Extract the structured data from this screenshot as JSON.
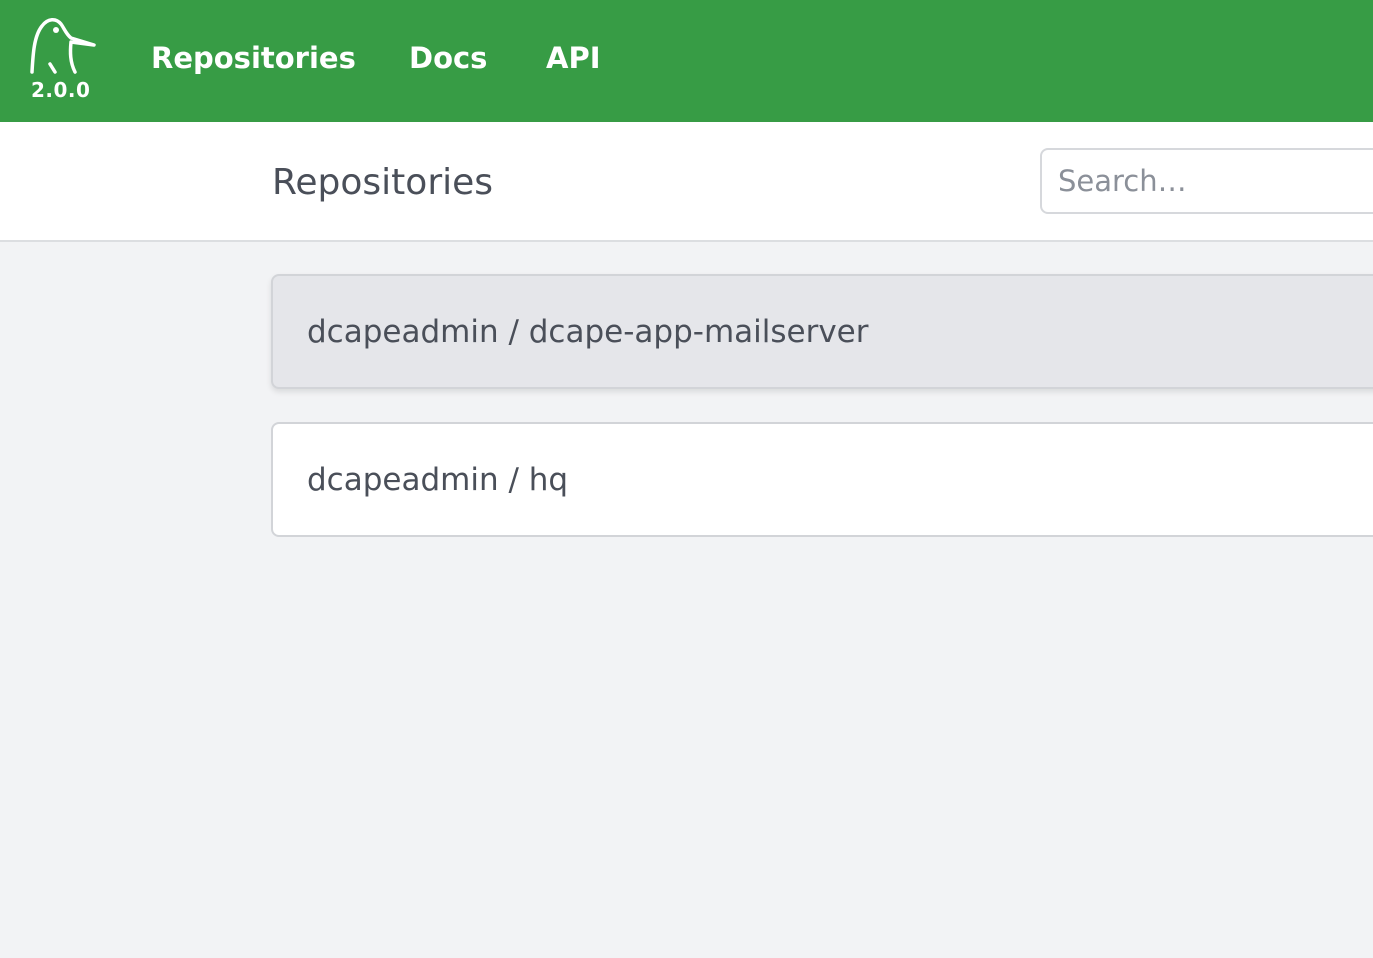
{
  "app": {
    "version": "2.0.0",
    "logo_icon": "penguin-logo-icon",
    "brand_color": "#379c45"
  },
  "nav": {
    "links": [
      {
        "label": "Repositories"
      },
      {
        "label": "Docs"
      },
      {
        "label": "API"
      }
    ]
  },
  "header": {
    "title": "Repositories",
    "search_placeholder": "Search…"
  },
  "repositories": [
    {
      "owner": "dcapeadmin",
      "name": "dcape-app-mailserver",
      "label": "dcapeadmin / dcape-app-mailserver",
      "hovered": true
    },
    {
      "owner": "dcapeadmin",
      "name": "hq",
      "label": "dcapeadmin / hq",
      "hovered": false
    }
  ]
}
